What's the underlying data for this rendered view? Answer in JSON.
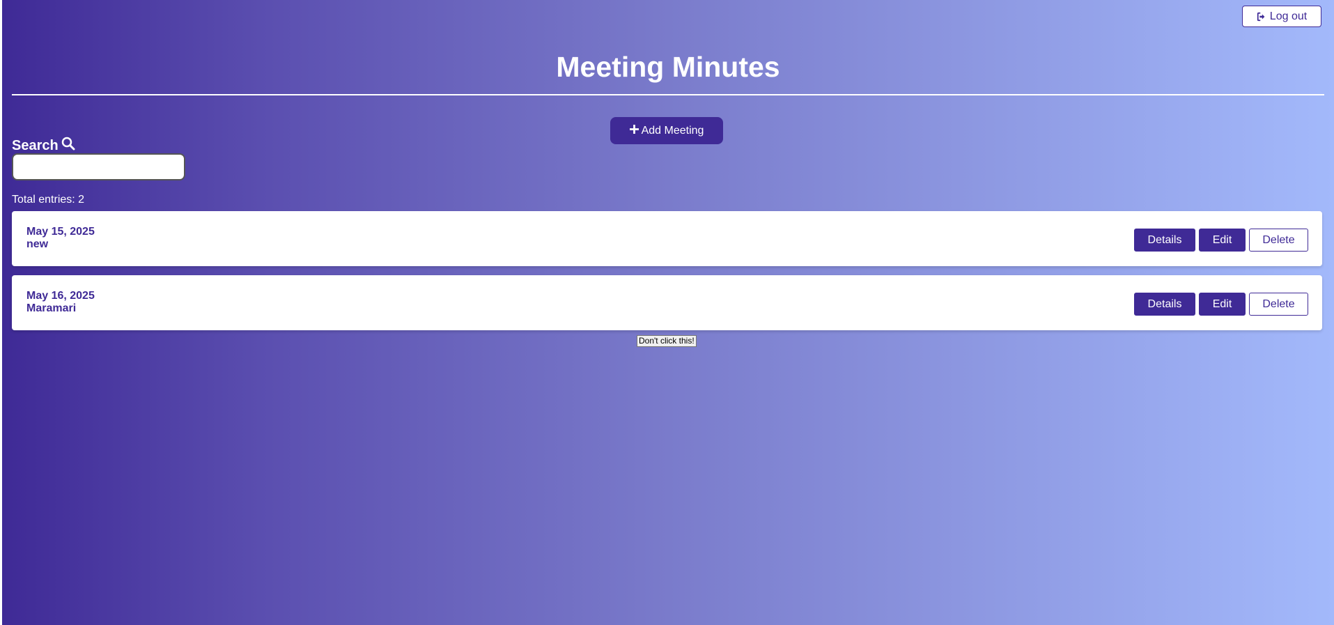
{
  "header": {
    "logout_label": "Log out",
    "logout_icon": "sign-out-icon"
  },
  "page": {
    "title": "Meeting Minutes"
  },
  "toolbar": {
    "add_label": "Add Meeting",
    "add_icon": "plus-icon"
  },
  "search": {
    "label": "Search",
    "icon": "search-icon",
    "value": "",
    "placeholder": ""
  },
  "summary": {
    "total_entries": "Total entries: 2"
  },
  "entries": [
    {
      "date": "May 15, 2025",
      "name": "new",
      "details_label": "Details",
      "edit_label": "Edit",
      "delete_label": "Delete"
    },
    {
      "date": "May 16, 2025",
      "name": "Maramari",
      "details_label": "Details",
      "edit_label": "Edit",
      "delete_label": "Delete"
    }
  ],
  "footer": {
    "dont_click_label": "Don't click this!"
  },
  "colors": {
    "accent": "#3f2a96",
    "gradient_start": "#3f2a96",
    "gradient_end": "#a3b9fb",
    "card_background": "#ffffff"
  }
}
